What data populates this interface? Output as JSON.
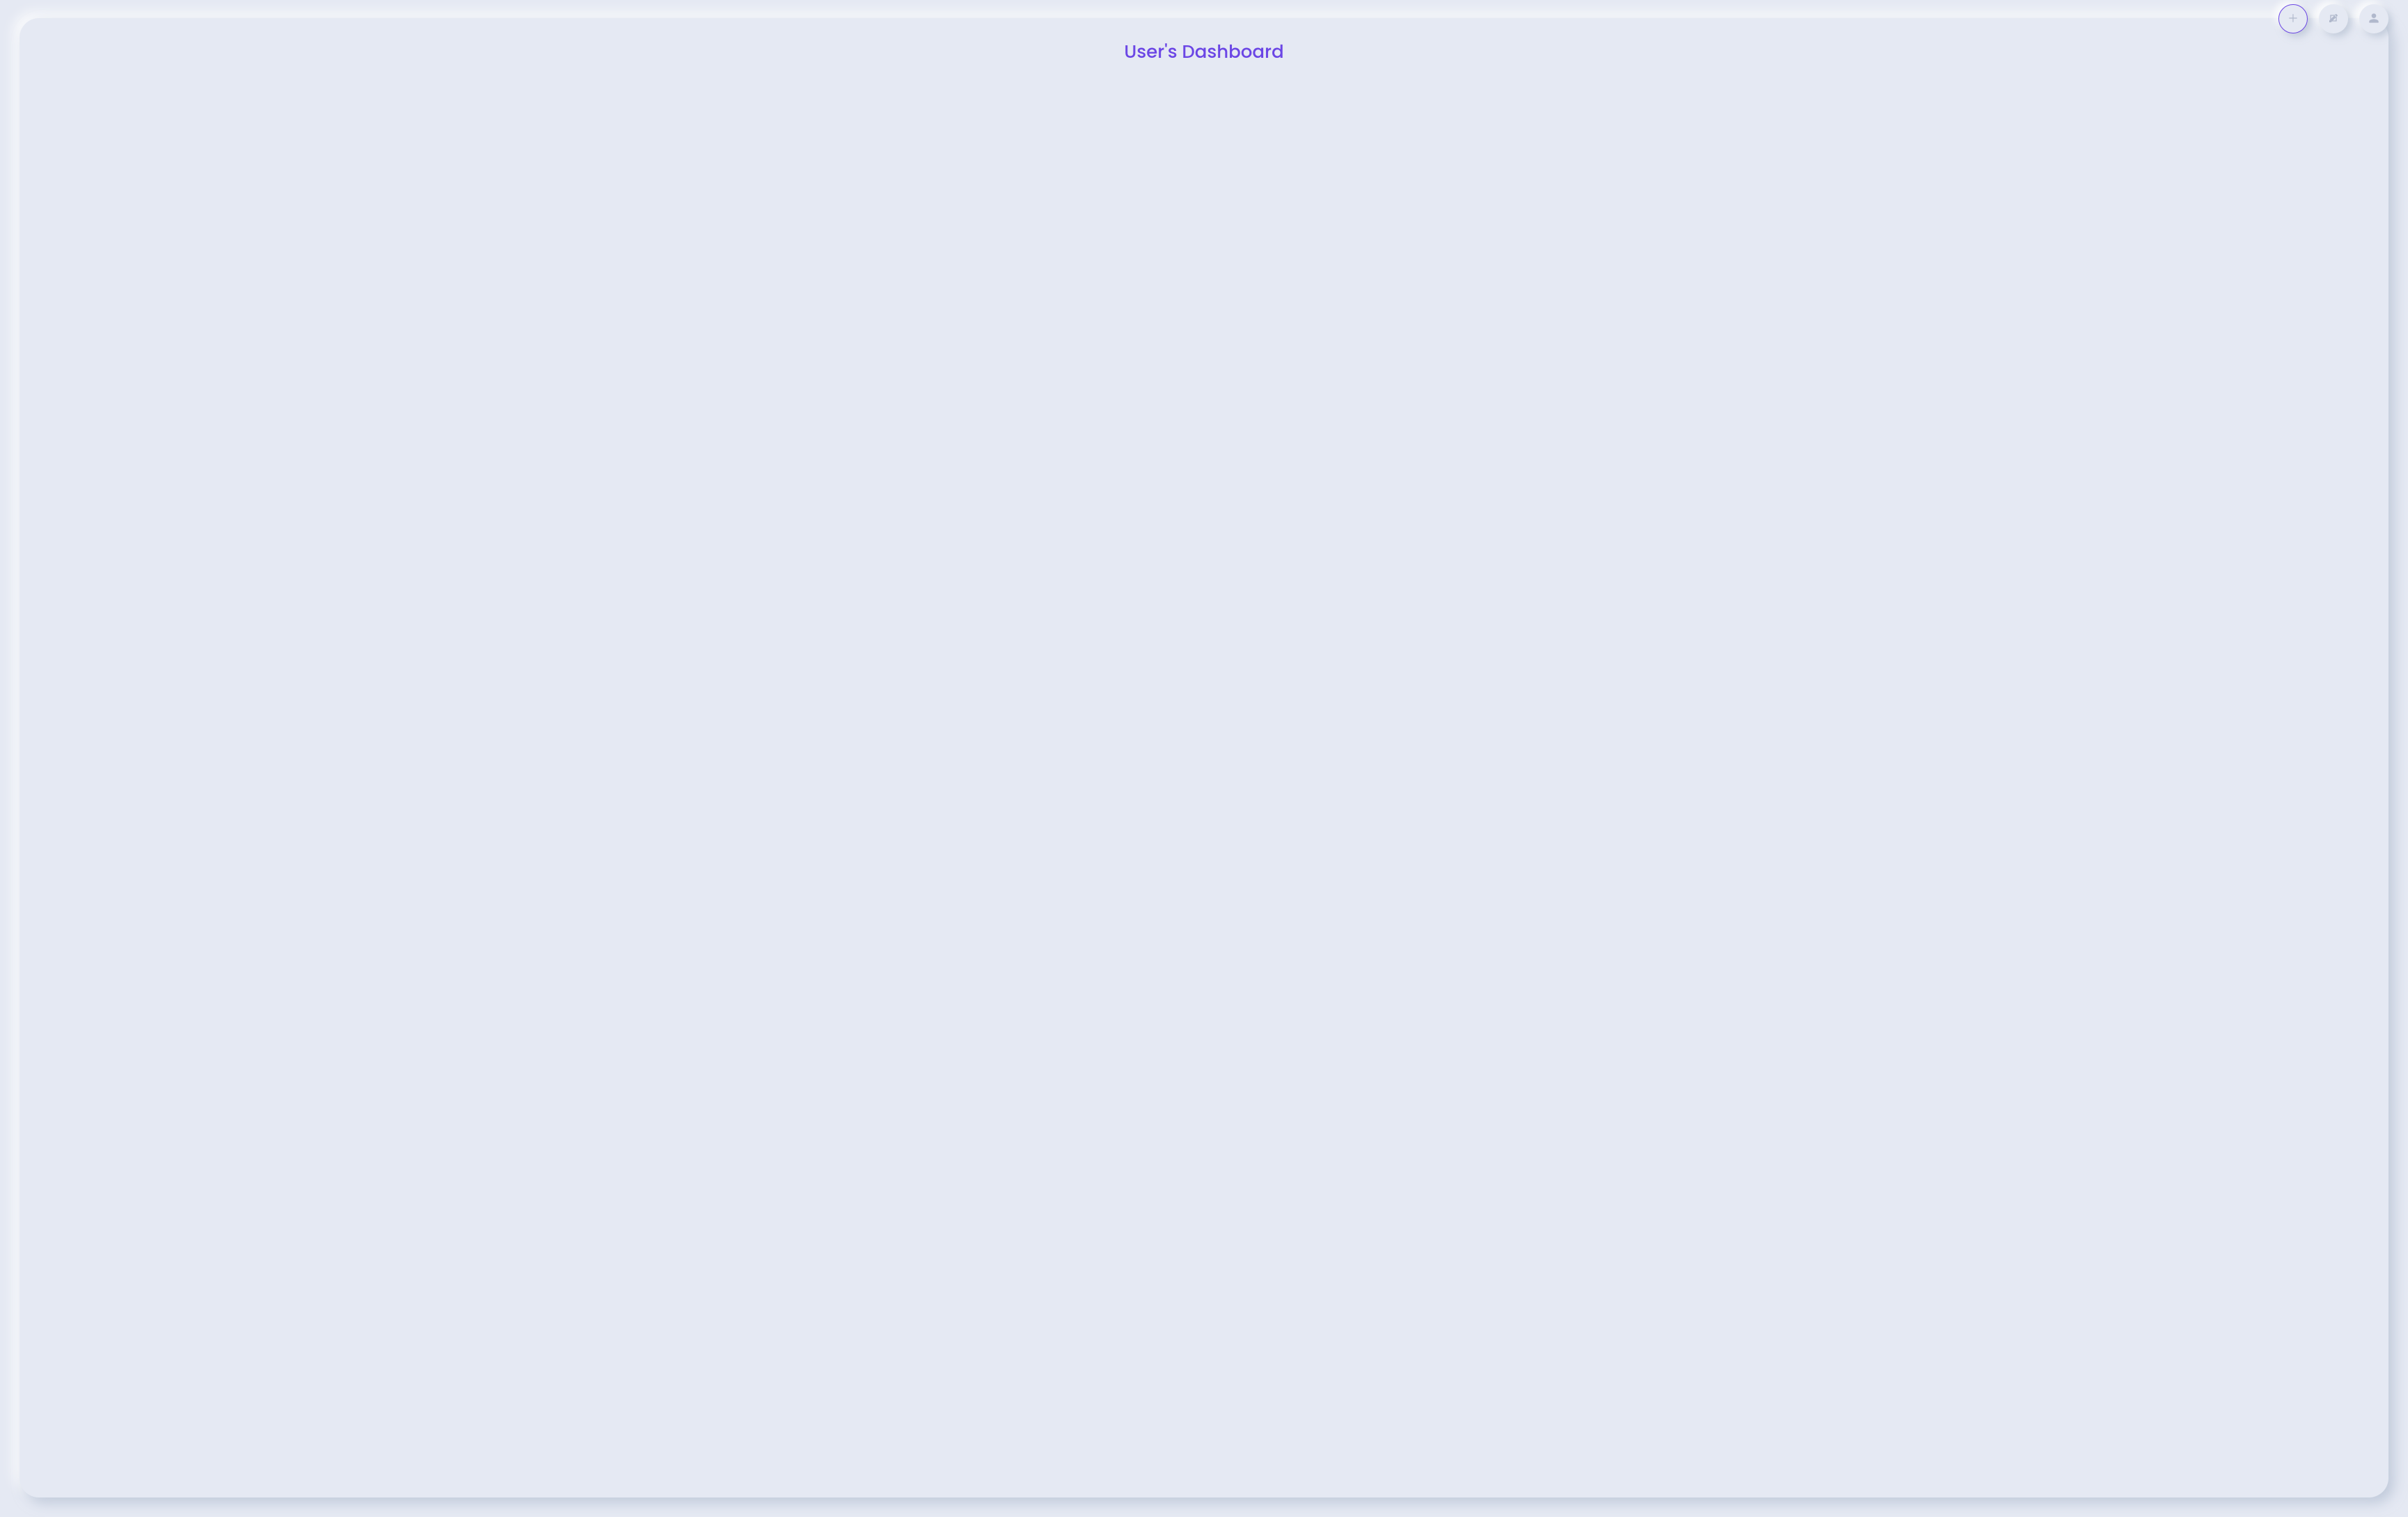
{
  "header": {
    "title": "User's Dashboard"
  },
  "toolbar": {
    "buttons": [
      {
        "name": "add-button",
        "icon": "plus-icon",
        "active": true
      },
      {
        "name": "edit-button",
        "icon": "edit-icon",
        "active": false
      },
      {
        "name": "profile-button",
        "icon": "user-icon",
        "active": false
      }
    ]
  },
  "colors": {
    "accent": "#6b46e5",
    "background": "#e5e9f3",
    "iconMuted": "#b0b8cc"
  }
}
